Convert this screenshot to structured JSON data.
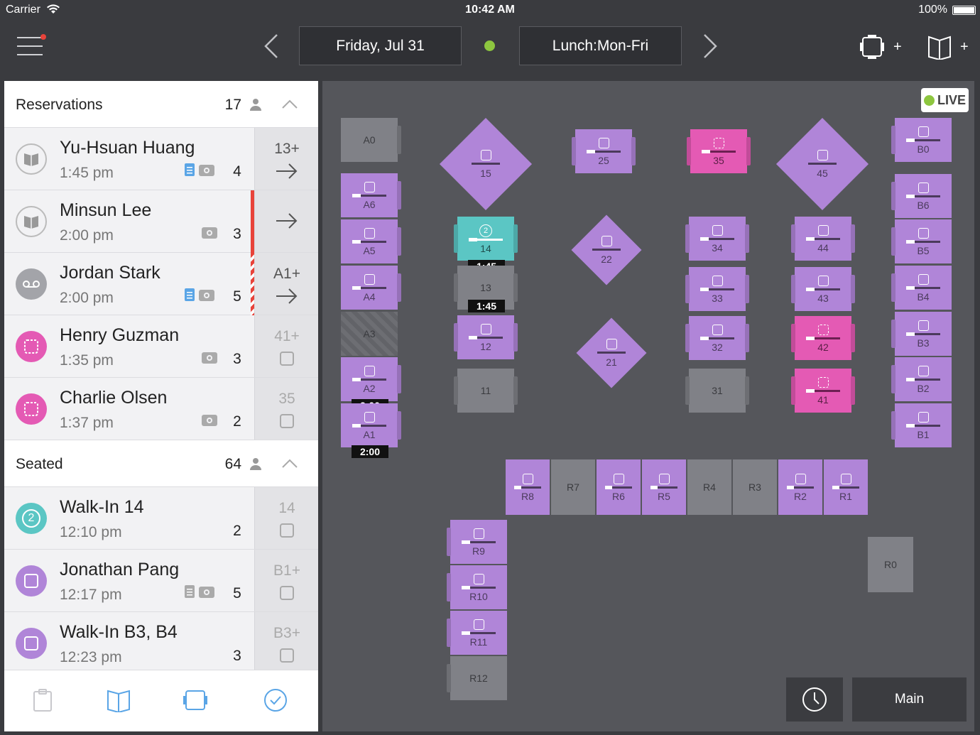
{
  "status": {
    "carrier": "Carrier",
    "time": "10:42 AM",
    "battery": "100%"
  },
  "nav": {
    "date": "Friday, Jul 31",
    "shift": "Lunch:Mon-Fri",
    "add_table": "+",
    "add_book": "+"
  },
  "reservations": {
    "title": "Reservations",
    "count": "17",
    "items": [
      {
        "name": "Yu-Hsuan Huang",
        "time": "1:45 pm",
        "party": "4",
        "tag": "13+",
        "action": "arrow",
        "avatar": "book-icon",
        "notes": true
      },
      {
        "name": "Minsun Lee",
        "time": "2:00 pm",
        "party": "3",
        "tag": "",
        "action": "arrow",
        "avatar": "book-icon",
        "notes": false
      },
      {
        "name": "Jordan Stark",
        "time": "2:00 pm",
        "party": "5",
        "tag": "A1+",
        "action": "arrow",
        "avatar": "voicemail-icon",
        "notes": true
      },
      {
        "name": "Henry Guzman",
        "time": "1:35 pm",
        "party": "3",
        "tag": "41+",
        "action": "table",
        "avatar": "table-icon",
        "notes": false
      },
      {
        "name": "Charlie Olsen",
        "time": "1:37 pm",
        "party": "2",
        "tag": "35",
        "action": "table",
        "avatar": "table-icon",
        "notes": false
      }
    ]
  },
  "seated": {
    "title": "Seated",
    "count": "64",
    "items": [
      {
        "name": "Walk-In 14",
        "time": "12:10 pm",
        "party": "2",
        "tag": "14",
        "avatar_text": "2",
        "notes": false
      },
      {
        "name": "Jonathan Pang",
        "time": "12:17 pm",
        "party": "5",
        "tag": "B1+",
        "avatar_text": "",
        "notes": true
      },
      {
        "name": "Walk-In B3, B4",
        "time": "12:23 pm",
        "party": "3",
        "tag": "B3+",
        "avatar_text": "",
        "notes": false
      }
    ]
  },
  "floor": {
    "live": "LIVE",
    "main_button": "Main",
    "tables": {
      "A0": "A0",
      "A6": "A6",
      "A5": "A5",
      "A4": "A4",
      "A3": "A3",
      "A2": "A2",
      "A1": "A1",
      "t15": "15",
      "t25": "25",
      "t35": "35",
      "t45": "45",
      "t14": "14",
      "t13": "13",
      "t12": "12",
      "t11": "11",
      "t22": "22",
      "t21": "21",
      "t34": "34",
      "t33": "33",
      "t32": "32",
      "t31": "31",
      "t44": "44",
      "t43": "43",
      "t42": "42",
      "t41": "41",
      "B0": "B0",
      "B6": "B6",
      "B5": "B5",
      "B4": "B4",
      "B3": "B3",
      "B2": "B2",
      "B1": "B1",
      "R8": "R8",
      "R7": "R7",
      "R6": "R6",
      "R5": "R5",
      "R4": "R4",
      "R3": "R3",
      "R2": "R2",
      "R1": "R1",
      "R9": "R9",
      "R10": "R10",
      "R11": "R11",
      "R12": "R12",
      "R0": "R0"
    },
    "time_tags": {
      "t14": "1:45",
      "t13": "1:45",
      "A2": "2:00",
      "A1": "2:00"
    },
    "teal_count": "2"
  },
  "colors": {
    "seated": "#b085d8",
    "reserved": "#e45ab4",
    "walkin": "#5bc6c4",
    "empty": "#808187",
    "live": "#8dc63f",
    "alert": "#e8433a"
  }
}
